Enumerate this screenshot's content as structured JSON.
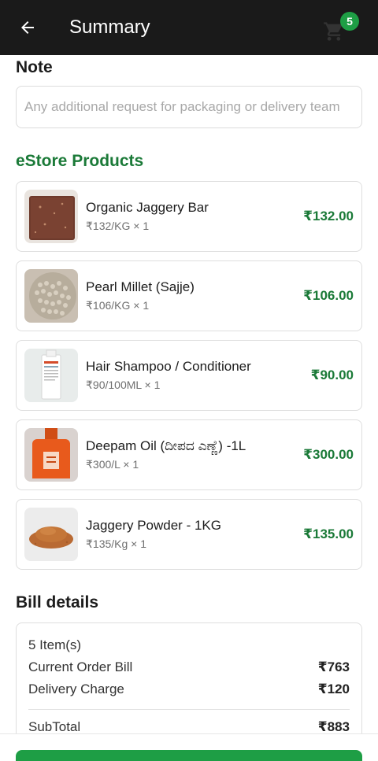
{
  "header": {
    "title": "Summary",
    "cart_count": "5",
    "back_icon": "arrow-left-icon",
    "cart_icon": "cart-icon"
  },
  "note": {
    "title": "Note",
    "placeholder": "Any additional request for packaging or delivery team",
    "value": ""
  },
  "estore": {
    "title": "eStore Products",
    "products": [
      {
        "name": "Organic Jaggery Bar",
        "qty": "₹132/KG × 1",
        "price": "₹132.00"
      },
      {
        "name": "Pearl Millet (Sajje)",
        "qty": "₹106/KG × 1",
        "price": "₹106.00"
      },
      {
        "name": "Hair Shampoo / Conditioner",
        "qty": "₹90/100ML × 1",
        "price": "₹90.00"
      },
      {
        "name": "Deepam Oil (ದೀಪದ ಎಣ್ಣೆ) -1L",
        "qty": "₹300/L × 1",
        "price": "₹300.00"
      },
      {
        "name": "Jaggery Powder - 1KG",
        "qty": "₹135/Kg × 1",
        "price": "₹135.00"
      }
    ]
  },
  "bill": {
    "title": "Bill details",
    "items_count": "5 Item(s)",
    "current_order_label": "Current Order Bill",
    "current_order_value": "₹763",
    "delivery_label": "Delivery Charge",
    "delivery_value": "₹120",
    "subtotal_label": "SubTotal",
    "subtotal_value": "₹883"
  },
  "colors": {
    "header_bg": "#1a1a1a",
    "accent_green": "#1b7a38",
    "badge_green": "#1e9e45"
  }
}
